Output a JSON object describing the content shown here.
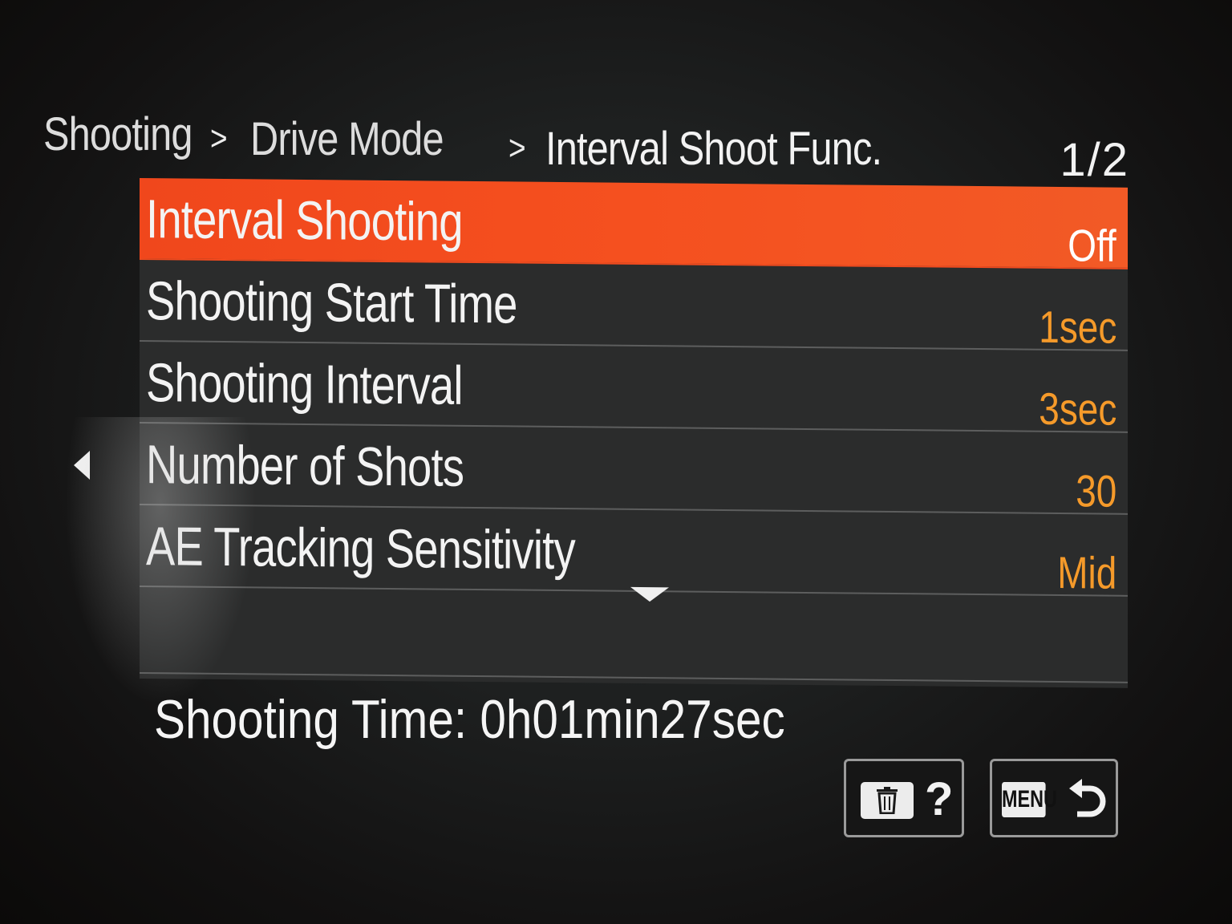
{
  "breadcrumb": {
    "level1": "Shooting",
    "sep1": ">",
    "level2": "Drive Mode",
    "sep2": ">",
    "level3": "Interval Shoot Func."
  },
  "page_indicator": "1/2",
  "menu": {
    "items": [
      {
        "label": "Interval Shooting",
        "value": "Off",
        "selected": true
      },
      {
        "label": "Shooting Start Time",
        "value": "1sec",
        "selected": false
      },
      {
        "label": "Shooting Interval",
        "value": "3sec",
        "selected": false
      },
      {
        "label": "Number of Shots",
        "value": "30",
        "selected": false
      },
      {
        "label": "AE Tracking Sensitivity",
        "value": "Mid",
        "selected": false
      }
    ]
  },
  "status": {
    "shooting_time": "Shooting Time: 0h01min27sec"
  },
  "buttons": {
    "help_glyph": "?",
    "menu_key": "MENU"
  },
  "colors": {
    "highlight": "#f24a1e",
    "value_orange": "#f59a2a",
    "text": "#f3f3f3",
    "panel": "#2b2c2c"
  },
  "icons": {
    "trash": "trash-icon",
    "return": "return-icon",
    "scroll_down": "scroll-down-icon",
    "left_arrow": "left-arrow-icon"
  }
}
